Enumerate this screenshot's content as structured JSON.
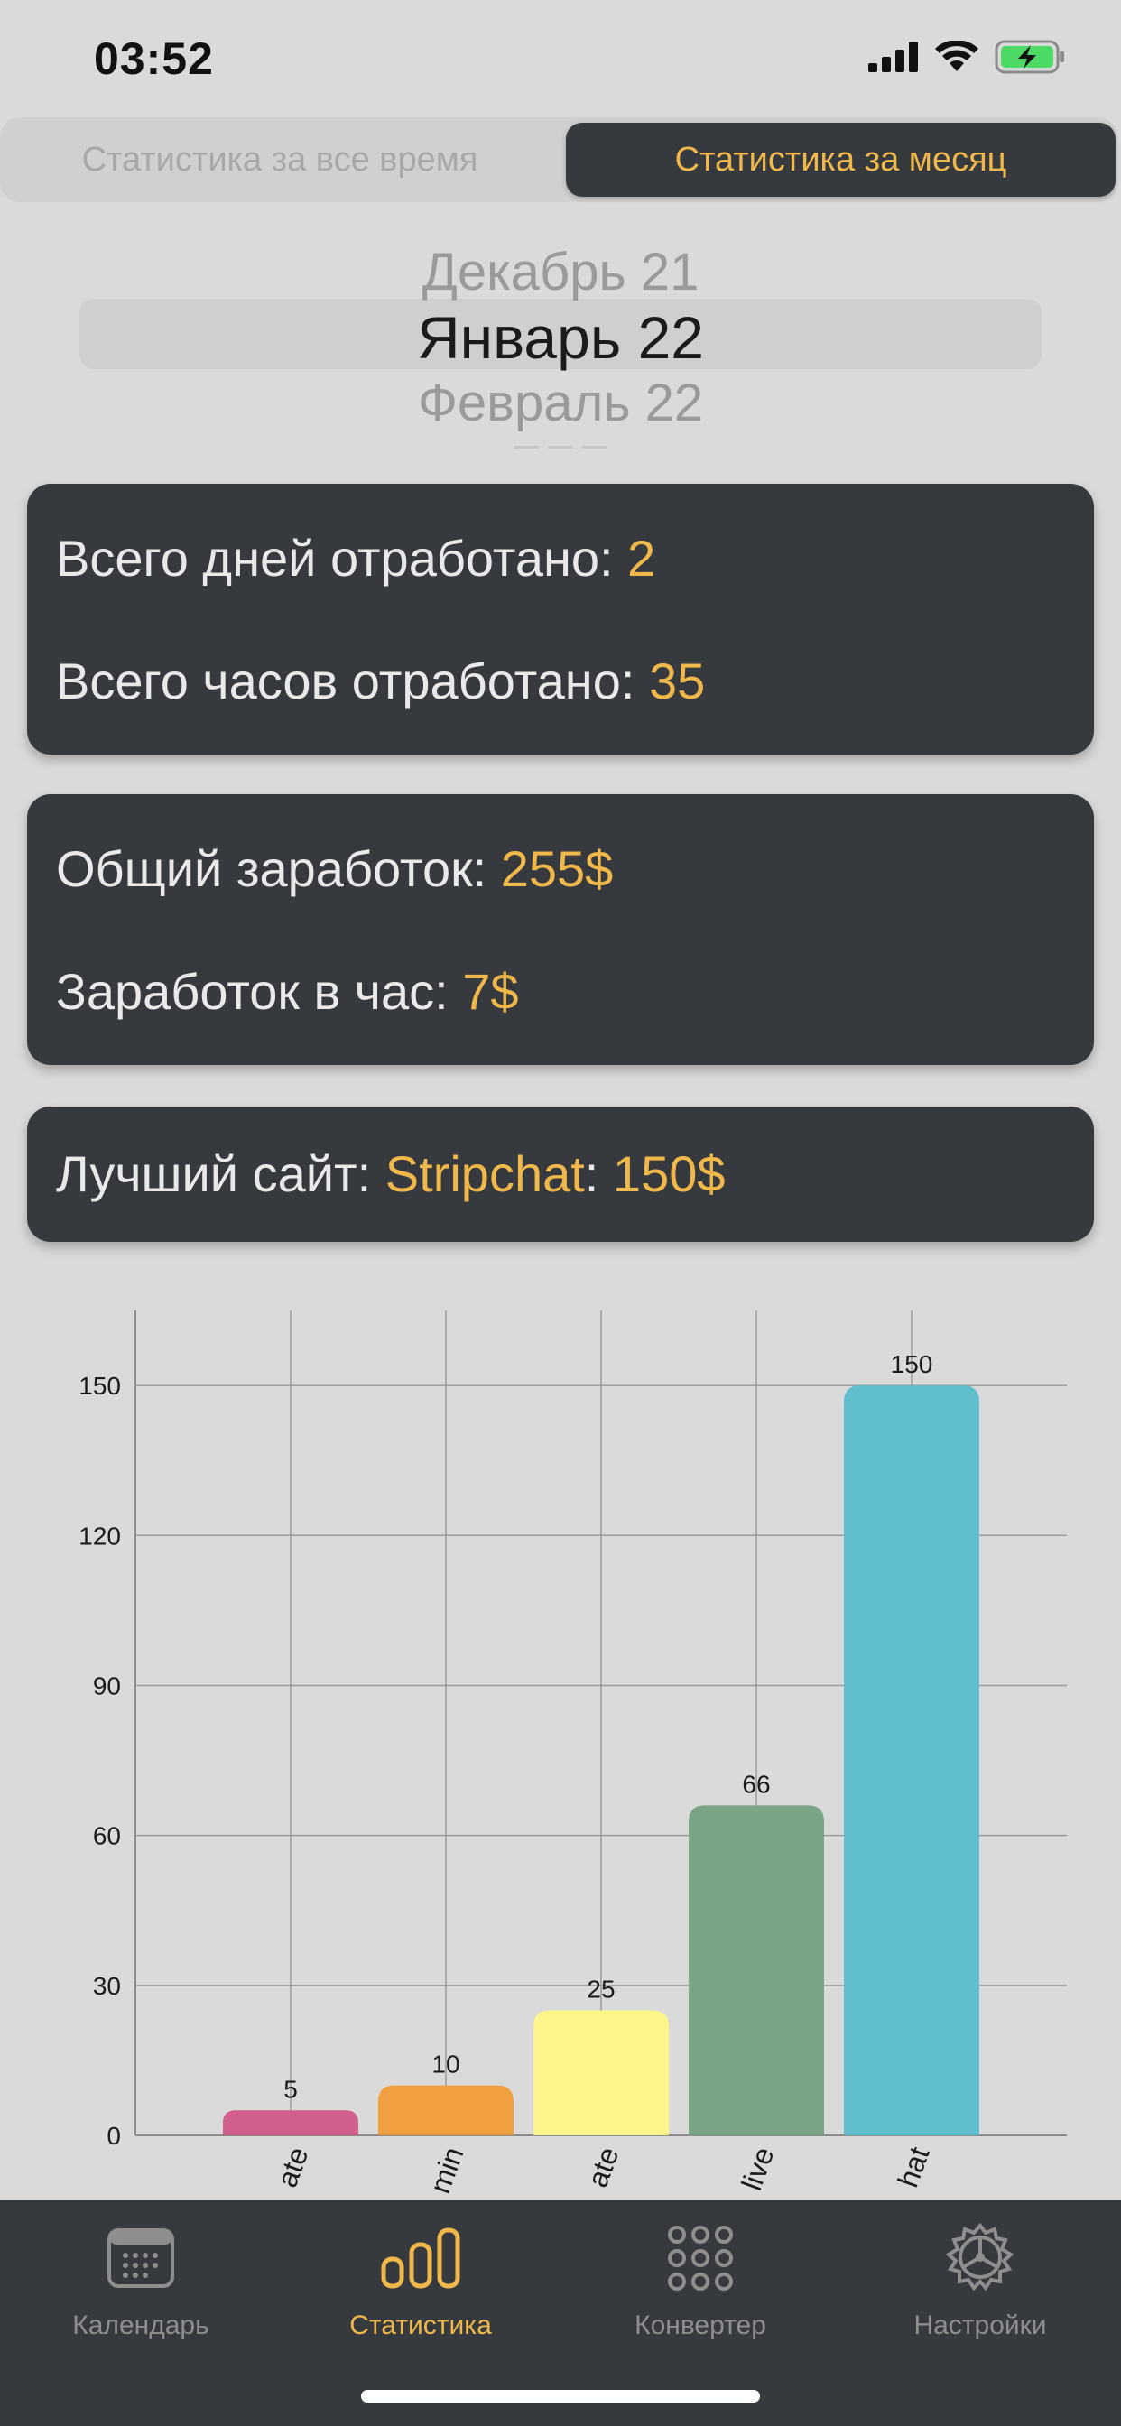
{
  "status_bar": {
    "time": "03:52"
  },
  "segmented": {
    "left_label": "Статистика за все время",
    "right_label": "Статистика за месяц",
    "selected": "right"
  },
  "picker": {
    "prev": "Декабрь 21",
    "selected": "Январь 22",
    "next": "Февраль 22"
  },
  "cards": {
    "days_label": "Всего дней отработано: ",
    "days_value": "2",
    "hours_label": "Всего часов отработано: ",
    "hours_value": "35",
    "total_label": "Общий заработок: ",
    "total_value": "255$",
    "per_hour_label": "Заработок в час: ",
    "per_hour_value": "7$",
    "best_label": "Лучший сайт: ",
    "best_site": "Stripchat",
    "best_sep": ": ",
    "best_value": "150$"
  },
  "colors": {
    "accent": "#f0b84a",
    "card_bg": "#363a3e",
    "background": "#dadada",
    "bar_1": "#d05f8e",
    "bar_2": "#f0a040",
    "bar_3": "#fcf68a",
    "bar_4": "#79a586",
    "bar_5": "#61bece"
  },
  "chart_data": {
    "type": "bar",
    "categories": [
      "ate",
      "min",
      "ate",
      "live",
      "hat"
    ],
    "values": [
      5,
      10,
      25,
      66,
      150
    ],
    "value_labels": [
      "5",
      "10",
      "25",
      "66",
      "150"
    ],
    "bar_colors": [
      "#d05f8e",
      "#f0a040",
      "#fcf68a",
      "#79a586",
      "#61bece"
    ],
    "yticks": [
      "0",
      "30",
      "60",
      "90",
      "120",
      "150"
    ],
    "ylim": [
      0,
      165
    ],
    "grid": true,
    "title": "",
    "xlabel": "",
    "ylabel": ""
  },
  "tabbar": {
    "items": [
      {
        "label": "Календарь",
        "icon": "calendar-icon",
        "active": false
      },
      {
        "label": "Статистика",
        "icon": "chart-icon",
        "active": true
      },
      {
        "label": "Конвертер",
        "icon": "grid-icon",
        "active": false
      },
      {
        "label": "Настройки",
        "icon": "settings-icon",
        "active": false
      }
    ]
  }
}
